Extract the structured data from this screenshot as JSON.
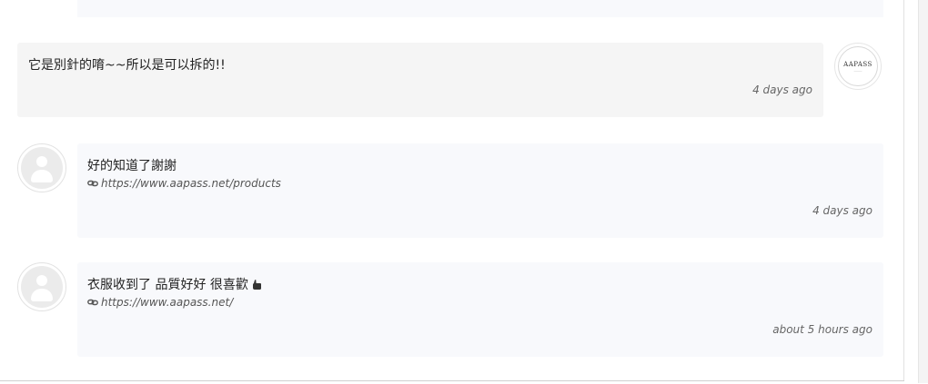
{
  "comments": [
    {
      "author_type": "admin",
      "avatar_logo": "AAPASS",
      "text": "它是別針的唷~~所以是可以拆的!!",
      "time": "4 days ago"
    },
    {
      "author_type": "user",
      "text": "好的知道了謝謝",
      "link": "https://www.aapass.net/products",
      "time": "4 days ago"
    },
    {
      "author_type": "user",
      "text": "衣服收到了 品質好好 很喜歡",
      "emoji_icon": "thumbs-up-icon",
      "link": "https://www.aapass.net/",
      "time": "about 5 hours ago"
    }
  ],
  "icons": {
    "link": "link-icon",
    "avatar_placeholder": "user-avatar-icon"
  },
  "colors": {
    "admin_bubble": "#f5f5f5",
    "user_bubble": "#f8f9fc"
  }
}
